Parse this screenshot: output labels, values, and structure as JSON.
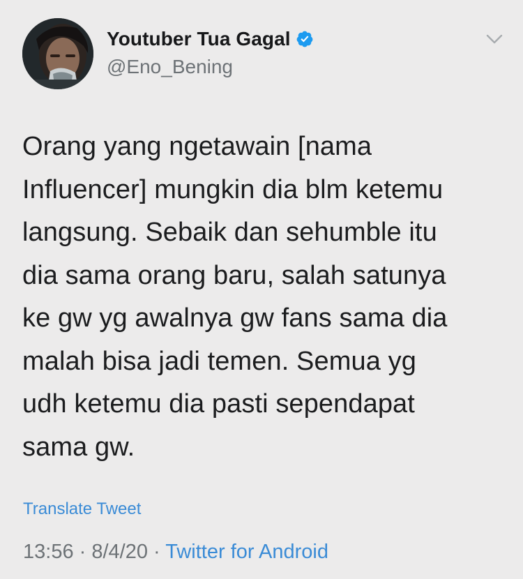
{
  "author": {
    "display_name": "Youtuber Tua Gagal",
    "handle": "@Eno_Bening",
    "verified": true,
    "avatar_icon": "profile-photo",
    "verified_icon": "verified-badge-icon",
    "verified_color": "#1d9bf0"
  },
  "tweet": {
    "lines": [
      "Orang yang ngetawain [nama",
      "Influencer] mungkin dia blm ketemu",
      "langsung. Sebaik dan sehumble itu",
      "dia sama orang baru, salah satunya",
      "ke gw yg awalnya gw fans sama dia",
      "malah bisa jadi temen. Semua yg",
      "udh ketemu dia pasti sependapat",
      "sama gw."
    ]
  },
  "translate_label": "Translate Tweet",
  "meta": {
    "time": "13:56",
    "separator": " · ",
    "date": "8/4/20",
    "source": "Twitter for Android"
  },
  "colors": {
    "background": "#ecebeb",
    "link": "#3a8bd6",
    "secondary_text": "#6d7276"
  }
}
